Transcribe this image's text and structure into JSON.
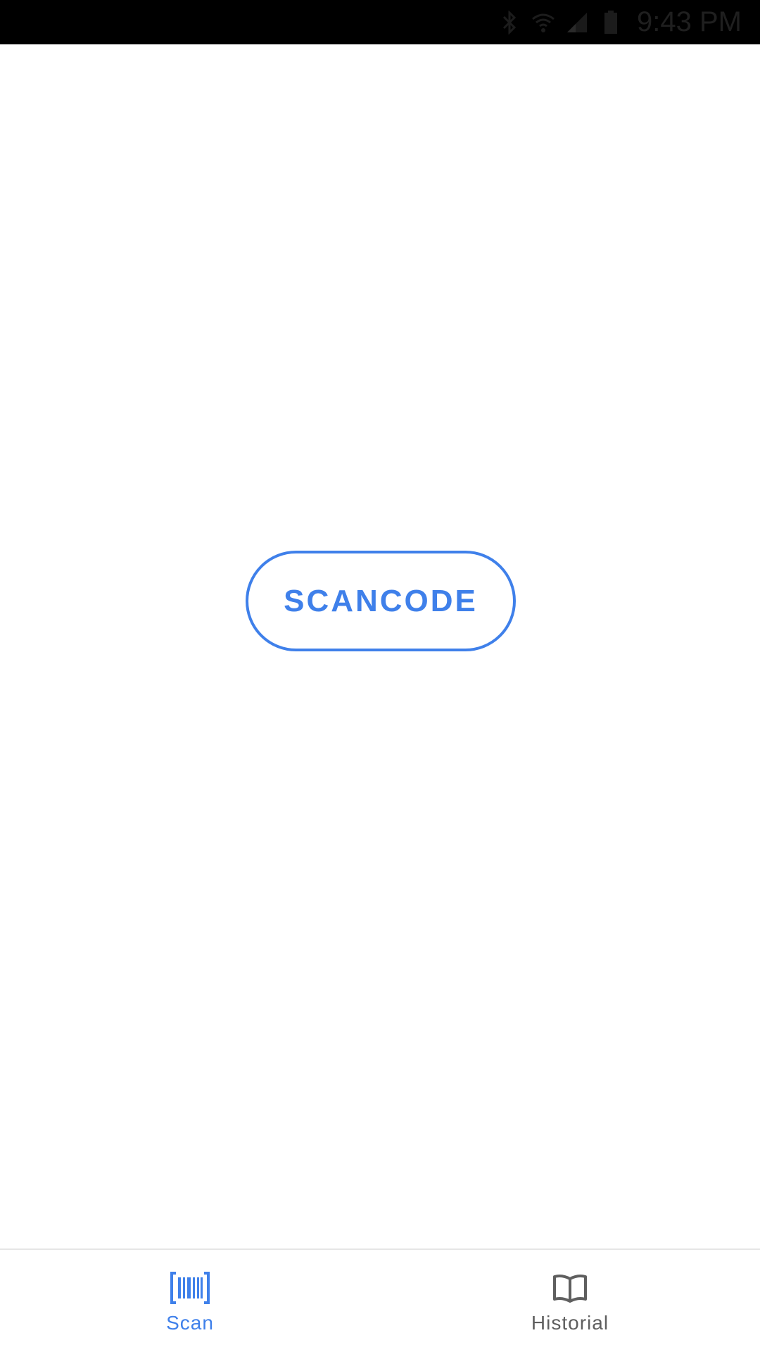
{
  "status_bar": {
    "time": "9:43 PM",
    "icons": [
      "bluetooth-icon",
      "wifi-icon",
      "signal-icon",
      "battery-icon"
    ]
  },
  "main": {
    "scan_button_label": "SCANCODE"
  },
  "bottom_nav": {
    "items": [
      {
        "label": "Scan",
        "icon": "barcode-icon",
        "active": true
      },
      {
        "label": "Historial",
        "icon": "book-icon",
        "active": false
      }
    ]
  },
  "colors": {
    "accent": "#3f80ea",
    "inactive": "#5f5f5f",
    "status_bar_bg": "#000000"
  }
}
